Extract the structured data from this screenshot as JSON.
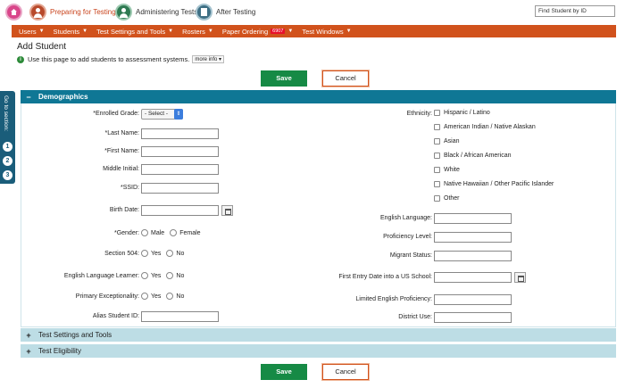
{
  "top_tabs": [
    {
      "label": "Preparing for Testing"
    },
    {
      "label": "Administering Tests"
    },
    {
      "label": "After Testing"
    }
  ],
  "find_student": {
    "placeholder": "Find Student by ID"
  },
  "nav": [
    {
      "label": "Users"
    },
    {
      "label": "Students"
    },
    {
      "label": "Test Settings and Tools"
    },
    {
      "label": "Rosters"
    },
    {
      "label": "Paper Ordering",
      "badge": "6907"
    },
    {
      "label": "Test Windows"
    }
  ],
  "page": {
    "title": "Add Student",
    "info_text": "Use this page to add students to assessment systems.",
    "more_info": "more info"
  },
  "buttons": {
    "save": "Save",
    "cancel": "Cancel"
  },
  "goto": {
    "label": "Go to section:",
    "numbers": [
      "1",
      "2",
      "3"
    ]
  },
  "sections": {
    "demographics": "Demographics",
    "test_settings": "Test Settings and Tools",
    "test_eligibility": "Test Eligibility"
  },
  "left_fields": {
    "enrolled_grade": "*Enrolled Grade:",
    "enrolled_grade_value": "- Select -",
    "last_name": "*Last Name:",
    "first_name": "*First Name:",
    "middle_initial": "Middle Initial:",
    "ssid": "*SSID:",
    "birth_date": "Birth Date:",
    "gender": "*Gender:",
    "gender_male": "Male",
    "gender_female": "Female",
    "section504": "Section 504:",
    "ell": "English Language Learner:",
    "primary_exceptionality": "Primary Exceptionality:",
    "yes": "Yes",
    "no": "No",
    "alias_student_id": "Alias Student ID:"
  },
  "ethnicity": {
    "label": "Ethnicity:",
    "options": [
      "Hispanic / Latino",
      "American Indian / Native Alaskan",
      "Asian",
      "Black / African American",
      "White",
      "Native Hawaiian / Other Pacific Islander",
      "Other"
    ]
  },
  "right_fields": {
    "english_language": "English Language:",
    "proficiency_level": "Proficiency Level:",
    "migrant_status": "Migrant Status:",
    "first_entry_date": "First Entry Date into a US School:",
    "limited_english": "Limited English Proficiency:",
    "district_use": "District Use:"
  },
  "icons": {
    "home": "home-icon",
    "prep": "person-icon",
    "admin": "person-icon",
    "after": "document-icon",
    "info": "info-icon",
    "calendar": "calendar-icon"
  },
  "colors": {
    "nav": "#d1521c",
    "section_active": "#0f7795",
    "section_collapsed": "#bddde5",
    "save": "#168a45"
  }
}
